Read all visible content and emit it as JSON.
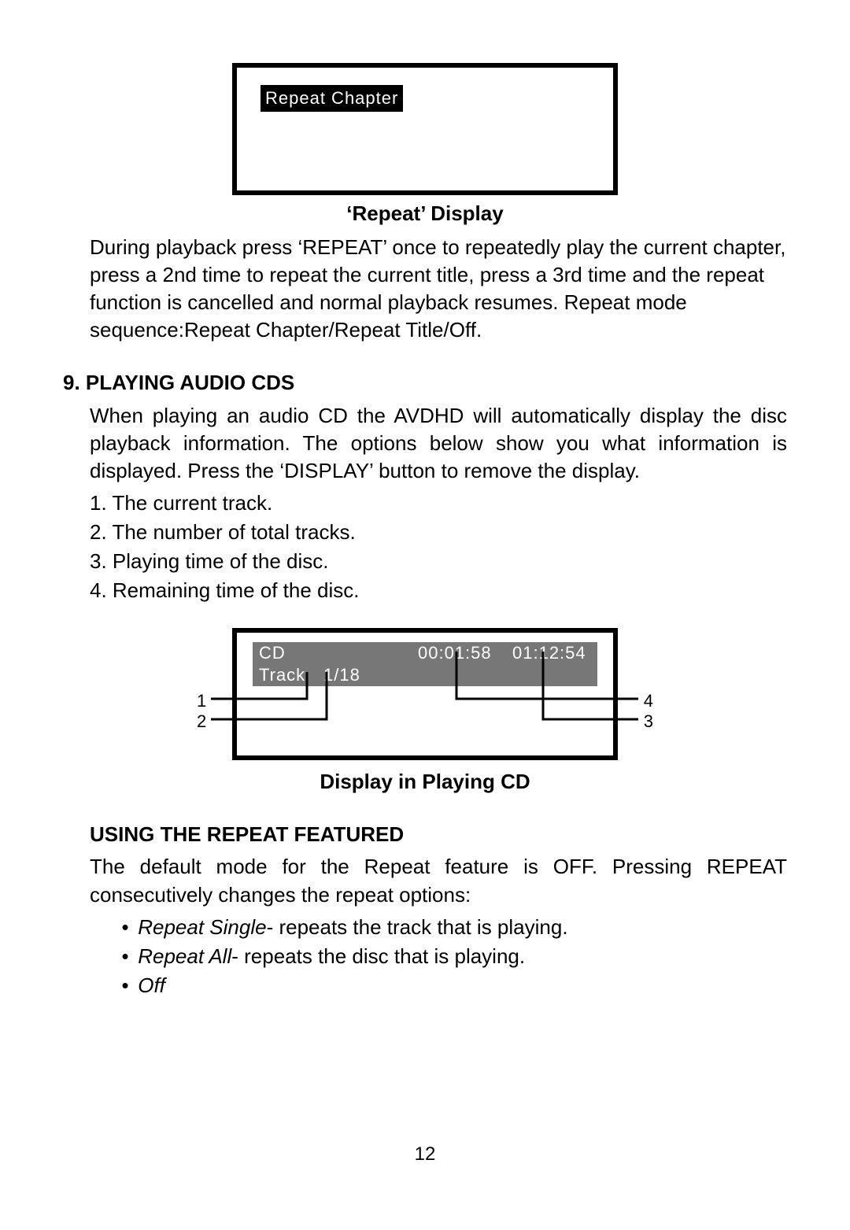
{
  "repeat_box": {
    "label": "Repeat Chapter"
  },
  "repeat_caption": "‘Repeat’ Display",
  "repeat_desc": "During playback press ‘REPEAT’ once to repeatedly play the current chapter, press a 2nd time to repeat the current title, press a 3rd time and the  repeat function is cancelled and normal playback resumes. Repeat mode sequence:Repeat Chapter/Repeat Title/Off.",
  "section9_title": "9. PLAYING AUDIO CDS",
  "section9_p1_a": "When playing an audio CD  the AVDHD will automatically display the disc playback information.  The options below show you what information is displayed. Press the ",
  "section9_p1_q1": "‘",
  "section9_p1_b": "DISPLAY",
  "section9_p1_q2": "’",
  "section9_p1_c": " button to remove the display.",
  "info_items": [
    "1. The current  track.",
    "2. The number of total tracks.",
    "3. Playing time of  the disc.",
    "4. Remaining time of  the disc."
  ],
  "cd_display": {
    "type": "CD",
    "elapsed": "00:01:58",
    "total": "01:12:54",
    "track_label": "Track",
    "track_value": "1/18"
  },
  "cd_caption": "Display in Playing CD",
  "callouts": {
    "c1": "1",
    "c2": "2",
    "c3": "3",
    "c4": "4"
  },
  "using_repeat_title": "USING THE REPEAT FEATURED",
  "using_repeat_desc": "The default mode for the Repeat feature is OFF. Pressing REPEAT consecutively  changes the repeat options:",
  "repeat_modes": [
    {
      "name": "Repeat Single",
      "desc": "- repeats the track that is playing."
    },
    {
      "name": "Repeat All",
      "desc": "- repeats the disc that is playing."
    },
    {
      "name": "Off",
      "desc": ""
    }
  ],
  "page_number": "12"
}
